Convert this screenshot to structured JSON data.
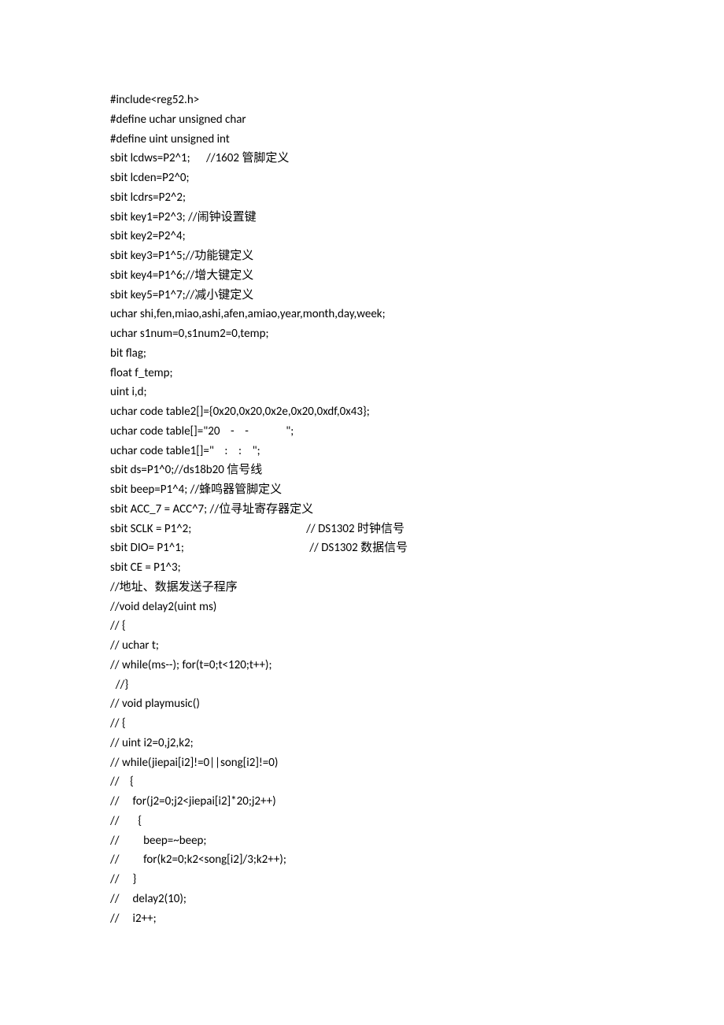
{
  "lines": [
    "#include<reg52.h>",
    "#define uchar unsigned char",
    "#define uint unsigned int",
    "sbit lcdws=P2^1;      //1602 管脚定义",
    "sbit lcden=P2^0;",
    "sbit lcdrs=P2^2;",
    "sbit key1=P2^3; //闹钟设置键",
    "sbit key2=P2^4;",
    "sbit key3=P1^5;//功能键定义",
    "sbit key4=P1^6;//增大键定义",
    "sbit key5=P1^7;//减小键定义",
    "uchar shi,fen,miao,ashi,afen,amiao,year,month,day,week;",
    "uchar s1num=0,s1num2=0,temp;",
    "bit flag;",
    "float f_temp;",
    "uint i,d;",
    "uchar code table2[]={0x20,0x20,0x2e,0x20,0xdf,0x43};",
    "uchar code table[]=\"20    -    -              \";",
    "uchar code table1[]=\"    :    :    \";",
    "sbit ds=P1^0;//ds18b20 信号线",
    "sbit beep=P1^4; //蜂鸣器管脚定义",
    "sbit ACC_7 = ACC^7; //位寻址寄存器定义",
    "sbit SCLK = P1^2;                                           // DS1302 时钟信号",
    "sbit DIO= P1^1;                                               // DS1302 数据信号",
    "sbit CE = P1^3;",
    "//地址、数据发送子程序",
    "//void delay2(uint ms)",
    "// {",
    "// uchar t;",
    "// while(ms--); for(t=0;t<120;t++);",
    "",
    "  //}",
    "// void playmusic()",
    "// {",
    "// uint i2=0,j2,k2;",
    "// while(jiepai[i2]!=0||song[i2]!=0)",
    "//    {",
    "//     for(j2=0;j2<jiepai[i2]*20;j2++)",
    "//       {",
    "//         beep=~beep;",
    "//         for(k2=0;k2<song[i2]/3;k2++);",
    "//     }",
    "//     delay2(10);",
    "//     i2++;"
  ]
}
